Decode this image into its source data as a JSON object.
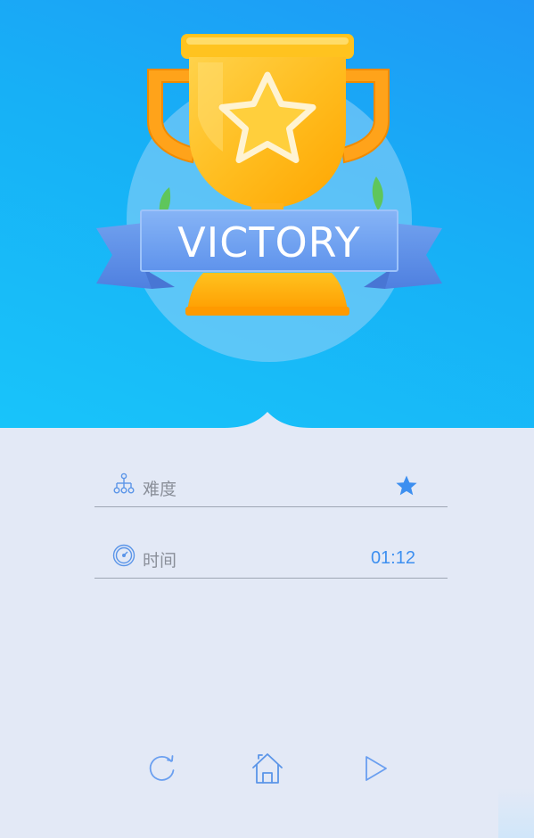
{
  "banner": {
    "title": "VICTORY"
  },
  "stats": {
    "difficulty": {
      "label": "难度",
      "icon": "hierarchy-icon",
      "value_icon": "star-icon",
      "stars": 1
    },
    "time": {
      "label": "时间",
      "icon": "stopwatch-icon",
      "value": "01:12"
    }
  },
  "actions": [
    {
      "name": "restart",
      "icon": "restart-icon"
    },
    {
      "name": "home",
      "icon": "home-icon"
    },
    {
      "name": "next",
      "icon": "play-icon"
    }
  ],
  "colors": {
    "sky_top": "#1f98f6",
    "sky_bottom": "#18c4fa",
    "panel": "#e3e9f6",
    "accent": "#3d8ff0",
    "trophy_gold": "#ffb400",
    "ribbon": "#6b9ef2"
  }
}
